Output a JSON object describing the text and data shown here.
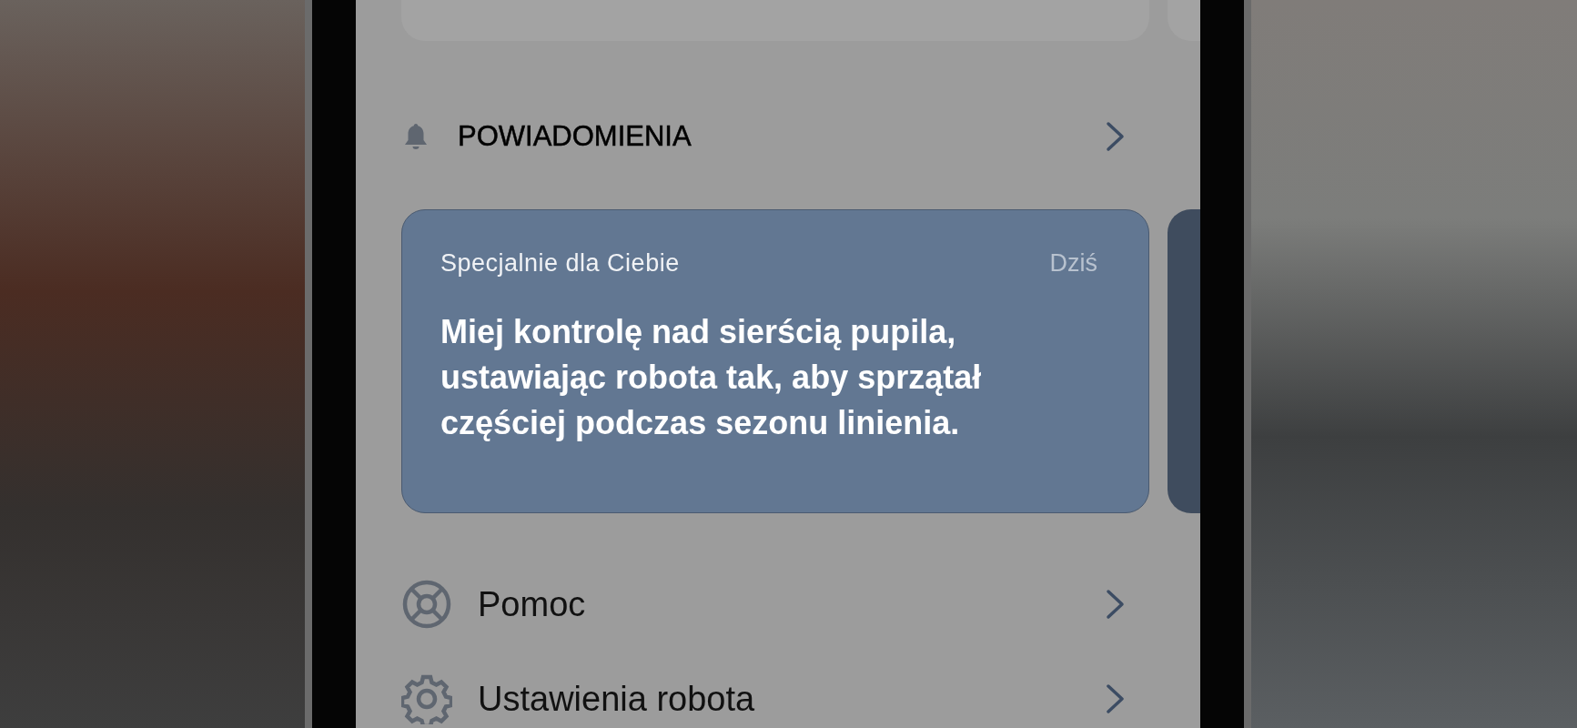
{
  "notifications": {
    "title": "POWIADOMIENIA"
  },
  "cards": [
    {
      "label": "Specjalnie dla Ciebie",
      "date": "Dziś",
      "message": "Miej kontrolę nad sierścią pupila, ustawiając robota tak, aby sprzątał częściej podczas sezonu linienia."
    }
  ],
  "menu": [
    {
      "kind": "help",
      "label": "Pomoc"
    },
    {
      "kind": "settings",
      "label": "Ustawienia robota"
    }
  ]
}
